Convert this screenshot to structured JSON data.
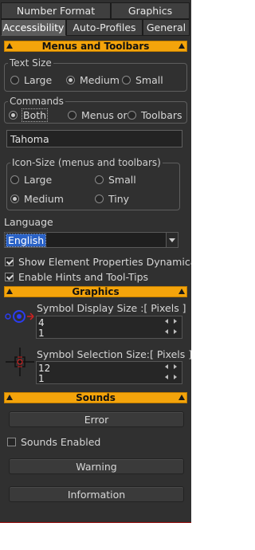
{
  "tabs": {
    "row1": [
      "Number Format",
      "Graphics"
    ],
    "row2": [
      "Accessibility",
      "Auto-Profiles",
      "General"
    ]
  },
  "menus_toolbars": {
    "header": "Menus and Toolbars",
    "text_size": {
      "title": "Text Size",
      "options": [
        "Large",
        "Medium",
        "Small"
      ],
      "selected": "Medium"
    },
    "commands": {
      "title": "Commands",
      "options": [
        "Both",
        "Menus or",
        "Toolbars"
      ],
      "selected": "Both"
    },
    "font_value": "Tahoma",
    "icon_size": {
      "title": "Icon-Size (menus and toolbars)",
      "options": [
        "Large",
        "Small",
        "Medium",
        "Tiny"
      ],
      "selected": "Medium"
    }
  },
  "language": {
    "label": "Language",
    "selected": "English"
  },
  "checks": {
    "show_props": {
      "label": "Show Element Properties Dynamically",
      "checked": true
    },
    "hints": {
      "label": "Enable Hints and Tool-Tips",
      "checked": true
    }
  },
  "graphics": {
    "header": "Graphics",
    "display_size": {
      "label": "Symbol Display Size   :[ Pixels ]",
      "value": "4",
      "value2": "1"
    },
    "selection_size": {
      "label": "Symbol Selection Size:[ Pixels ]",
      "value": "12",
      "value2": "1"
    }
  },
  "sounds": {
    "header": "Sounds",
    "error_label": "Error",
    "enabled": {
      "label": "Sounds Enabled",
      "checked": false
    },
    "warning_label": "Warning",
    "information_label": "Information"
  },
  "colors": {
    "accent": "#f4a40b",
    "panel": "#303030",
    "selection": "#2a62c7"
  }
}
